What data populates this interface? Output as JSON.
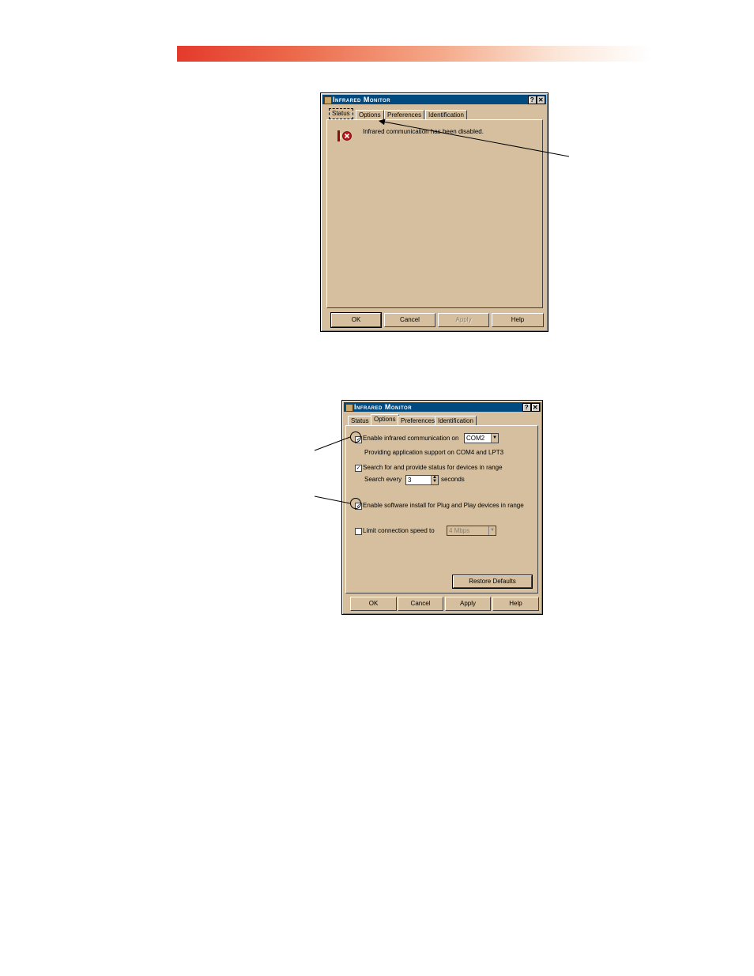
{
  "dialog1": {
    "title": "Infrared Monitor",
    "tabs": [
      "Status",
      "Options",
      "Preferences",
      "Identification"
    ],
    "active_tab": "Status",
    "status_message": "Infrared communication has been disabled.",
    "icon": "infrared-disabled-icon",
    "buttons": {
      "ok": "OK",
      "cancel": "Cancel",
      "apply": "Apply",
      "help": "Help"
    }
  },
  "dialog2": {
    "title": "Infrared Monitor",
    "tabs": [
      "Status",
      "Options",
      "Preferences",
      "Identification"
    ],
    "active_tab": "Options",
    "enable_ir_label": "Enable infrared communication on",
    "enable_ir_checked": true,
    "port_value": "COM2",
    "support_text": "Providing application support on COM4 and LPT3",
    "search_label": "Search for and provide status for devices in range",
    "search_checked": true,
    "search_every_label": "Search every",
    "search_every_value": "3",
    "seconds_label": "seconds",
    "pnp_label": "Enable software install for Plug and Play devices in range",
    "pnp_checked": true,
    "limit_label": "Limit connection speed to",
    "limit_checked": false,
    "speed_value": "4 Mbps",
    "restore_label": "Restore Defaults",
    "buttons": {
      "ok": "OK",
      "cancel": "Cancel",
      "apply": "Apply",
      "help": "Help"
    }
  },
  "colors": {
    "dialog_bg": "#d5bf9f",
    "titlebar": "#004a80",
    "header_red": "#e43a2c"
  }
}
